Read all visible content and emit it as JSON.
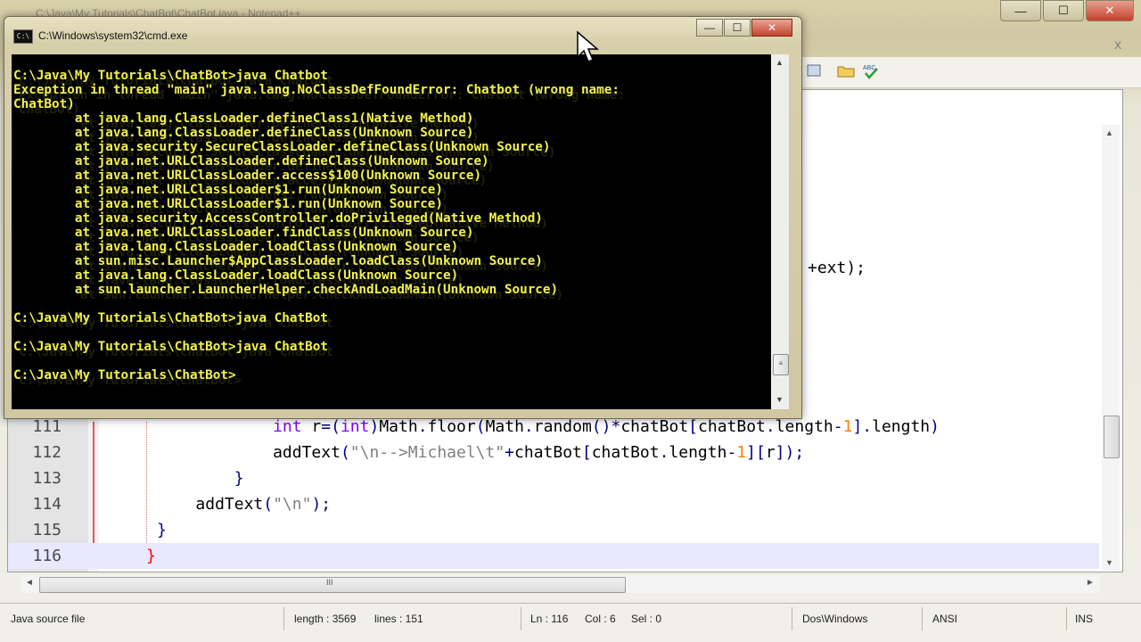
{
  "npp": {
    "title": "C:\\Java\\My Tutorials\\ChatBot\\ChatBot.java - Notepad++",
    "controls": {
      "minimize": "—",
      "maximize": "☐",
      "close": "✕"
    },
    "tab_close": "X",
    "ext_fragment": "+ext);",
    "code_lines": [
      {
        "number": "111",
        "segments": [
          {
            "t": "        ",
            "c": "txt"
          },
          {
            "t": "int",
            "c": "kw"
          },
          {
            "t": " r",
            "c": "txt"
          },
          {
            "t": "=(",
            "c": "op"
          },
          {
            "t": "int",
            "c": "kw"
          },
          {
            "t": ")",
            "c": "op"
          },
          {
            "t": "Math",
            "c": "txt"
          },
          {
            "t": ".",
            "c": "op"
          },
          {
            "t": "floor",
            "c": "txt"
          },
          {
            "t": "(",
            "c": "op"
          },
          {
            "t": "Math",
            "c": "txt"
          },
          {
            "t": ".",
            "c": "op"
          },
          {
            "t": "random",
            "c": "txt"
          },
          {
            "t": "()*",
            "c": "op"
          },
          {
            "t": "chatBot",
            "c": "txt"
          },
          {
            "t": "[",
            "c": "op"
          },
          {
            "t": "chatBot",
            "c": "txt"
          },
          {
            "t": ".",
            "c": "op"
          },
          {
            "t": "length",
            "c": "txt"
          },
          {
            "t": "-",
            "c": "op"
          },
          {
            "t": "1",
            "c": "num"
          },
          {
            "t": "].",
            "c": "op"
          },
          {
            "t": "length",
            "c": "txt"
          },
          {
            "t": ")",
            "c": "op"
          }
        ]
      },
      {
        "number": "112",
        "segments": [
          {
            "t": "        ",
            "c": "txt"
          },
          {
            "t": "addText",
            "c": "txt"
          },
          {
            "t": "(",
            "c": "op"
          },
          {
            "t": "\"\\n-->Michael\\t\"",
            "c": "str"
          },
          {
            "t": "+",
            "c": "op"
          },
          {
            "t": "chatBot",
            "c": "txt"
          },
          {
            "t": "[",
            "c": "op"
          },
          {
            "t": "chatBot",
            "c": "txt"
          },
          {
            "t": ".",
            "c": "op"
          },
          {
            "t": "length",
            "c": "txt"
          },
          {
            "t": "-",
            "c": "op"
          },
          {
            "t": "1",
            "c": "num"
          },
          {
            "t": "][",
            "c": "op"
          },
          {
            "t": "r",
            "c": "txt"
          },
          {
            "t": "]);",
            "c": "op"
          }
        ]
      },
      {
        "number": "113",
        "segments": [
          {
            "t": "      ",
            "c": "txt"
          },
          {
            "t": "}",
            "c": "br"
          }
        ]
      },
      {
        "number": "114",
        "segments": [
          {
            "t": "    ",
            "c": "txt"
          },
          {
            "t": "addText",
            "c": "txt"
          },
          {
            "t": "(",
            "c": "op"
          },
          {
            "t": "\"\\n\"",
            "c": "str"
          },
          {
            "t": ");",
            "c": "op"
          }
        ]
      },
      {
        "number": "115",
        "segments": [
          {
            "t": "  ",
            "c": "txt"
          },
          {
            "t": "}",
            "c": "br"
          }
        ]
      },
      {
        "number": "116",
        "segments": [
          {
            "t": "}",
            "c": "red"
          }
        ]
      }
    ],
    "status": {
      "file_type": "Java source file",
      "length": "length : 3569",
      "lines": "lines : 151",
      "ln": "Ln : 116",
      "col": "Col : 6",
      "sel": "Sel : 0",
      "eol": "Dos\\Windows",
      "encoding": "ANSI",
      "mode": "INS"
    },
    "scroll": {
      "grip": "III",
      "left": "◄",
      "right": "►",
      "up": "▲",
      "down": "▼"
    }
  },
  "cmd": {
    "title": "C:\\Windows\\system32\\cmd.exe",
    "icon_label": "C:\\",
    "controls": {
      "minimize": "—",
      "maximize": "☐",
      "close": "✕"
    },
    "console_lines": [
      "C:\\Java\\My Tutorials\\ChatBot>java Chatbot",
      "Exception in thread \"main\" java.lang.NoClassDefFoundError: Chatbot (wrong name:",
      "ChatBot)",
      "        at java.lang.ClassLoader.defineClass1(Native Method)",
      "        at java.lang.ClassLoader.defineClass(Unknown Source)",
      "        at java.security.SecureClassLoader.defineClass(Unknown Source)",
      "        at java.net.URLClassLoader.defineClass(Unknown Source)",
      "        at java.net.URLClassLoader.access$100(Unknown Source)",
      "        at java.net.URLClassLoader$1.run(Unknown Source)",
      "        at java.net.URLClassLoader$1.run(Unknown Source)",
      "        at java.security.AccessController.doPrivileged(Native Method)",
      "        at java.net.URLClassLoader.findClass(Unknown Source)",
      "        at java.lang.ClassLoader.loadClass(Unknown Source)",
      "        at sun.misc.Launcher$AppClassLoader.loadClass(Unknown Source)",
      "        at java.lang.ClassLoader.loadClass(Unknown Source)",
      "        at sun.launcher.LauncherHelper.checkAndLoadMain(Unknown Source)",
      "",
      "C:\\Java\\My Tutorials\\ChatBot>java ChatBot",
      "",
      "C:\\Java\\My Tutorials\\ChatBot>java ChatBot",
      "",
      "C:\\Java\\My Tutorials\\ChatBot>"
    ],
    "scroll": {
      "up": "▲",
      "down": "▼",
      "grip": "≡"
    }
  },
  "colors": {
    "console_text": "#f2f24c",
    "console_bg": "#000000",
    "keyword": "#8000ff",
    "string": "#808080",
    "number": "#ff8000",
    "operator": "#000080",
    "current_line": "#e8e8ff"
  }
}
